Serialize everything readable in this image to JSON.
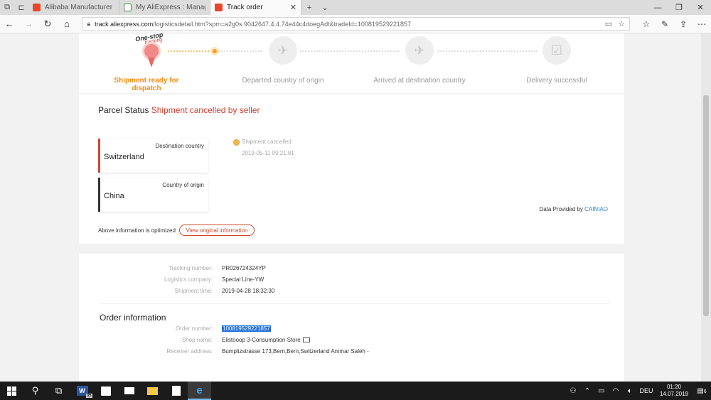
{
  "browser": {
    "tabs": [
      {
        "label": "Alibaba Manufacturer Direc",
        "active": false,
        "favicon": "alibaba-icon"
      },
      {
        "label": "My AliExpress : Manage Orc",
        "active": false,
        "favicon": "page-icon"
      },
      {
        "label": "Track order",
        "active": true,
        "favicon": "aliexpress-icon"
      }
    ],
    "url_host": "track.aliexpress.com",
    "url_rest": "/logisticsdetail.htm?spm=a2g0s.9042647.4.4.74e44c4doegAdt&tradeId=100819529221857"
  },
  "steps": [
    {
      "label": "Shipment ready for dispatch",
      "icon": "one-stop-tracking-icon",
      "active": true
    },
    {
      "label": "Departed country of origin",
      "icon": "plane-departure-icon",
      "active": false
    },
    {
      "label": "Arrived at destination country",
      "icon": "plane-arrival-icon",
      "active": false
    },
    {
      "label": "Delivery successful",
      "icon": "clipboard-check-icon",
      "active": false
    }
  ],
  "logo": {
    "line1": "One-stop",
    "line2": "Tracking"
  },
  "parcel": {
    "title_prefix": "Parcel Status",
    "status": "Shipment cancelled by seller",
    "destination_caption": "Destination country",
    "destination": "Switzerland",
    "origin_caption": "Country of origin",
    "origin": "China",
    "event_text": "Shipment cancelled",
    "event_time": "2019-05-11 09:21:01",
    "provided_prefix": "Data Provided by",
    "provider": "CAINIAO",
    "optimized_note": "Above information is optimized",
    "view_original": "View original information"
  },
  "shipment_info": {
    "tracking_label": "Tracking number:",
    "tracking_value": "PR026724324YP",
    "company_label": "Logistics company:",
    "company_value": "Special Line-YW",
    "time_label": "Shipment time:",
    "time_value": "2019-04-28 18:32:30"
  },
  "order_info": {
    "title": "Order information",
    "order_label": "Order number:",
    "order_value": "100819529221857",
    "shop_label": "Shop name:",
    "shop_value": "Elistooop 3-Consumption Store",
    "address_label": "Receiver address:",
    "address_value": "Bumplizstrasse 173,Bern,Bern,Switzerland Ammar Saleh -"
  },
  "taskbar": {
    "word_count": "35",
    "language": "DEU",
    "time": "01:20",
    "date": "14.07.2019",
    "notifications": "6"
  }
}
